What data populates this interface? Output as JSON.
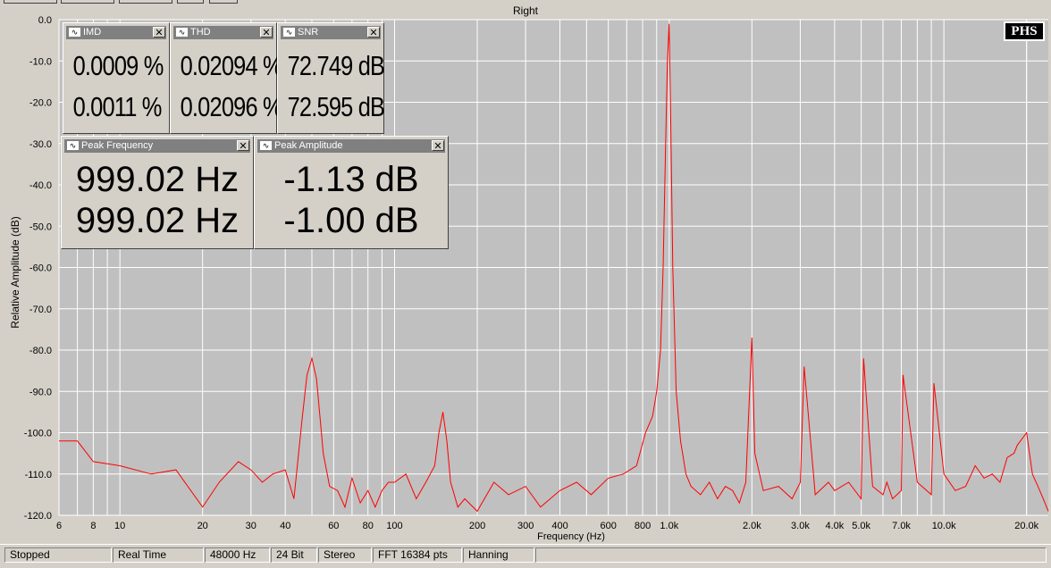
{
  "window": {
    "title": "Right"
  },
  "brand_badge": "PHS",
  "meters": {
    "imd": {
      "title": "IMD",
      "value1": "0.0009 %",
      "value2": "0.0011 %"
    },
    "thd": {
      "title": "THD",
      "value1": "0.02094 %",
      "value2": "0.02096 %"
    },
    "snr": {
      "title": "SNR",
      "value1": "72.749 dB",
      "value2": "72.595 dB"
    },
    "peak_frequency": {
      "title": "Peak Frequency",
      "value1": "999.02 Hz",
      "value2": "999.02 Hz"
    },
    "peak_amplitude": {
      "title": "Peak Amplitude",
      "value1": "-1.13 dB",
      "value2": "-1.00 dB"
    }
  },
  "close_glyph": "✕",
  "window_icon_glyph": "∿",
  "status": {
    "state": "Stopped",
    "mode": "Real Time",
    "sample_rate": "48000 Hz",
    "bit_depth": "24 Bit",
    "channels": "Stereo",
    "fft": "FFT 16384 pts",
    "window": "Hanning"
  },
  "colors": {
    "trace": "#ff0000",
    "plot_bg": "#c0c0c0",
    "grid": "#ffffff",
    "face": "#d4d0c8"
  },
  "chart_data": {
    "type": "line",
    "xlabel": "Frequency (Hz)",
    "ylabel": "Relative Amplitude (dB)",
    "xscale": "log",
    "xlim": [
      6,
      24000
    ],
    "ylim": [
      -120,
      0
    ],
    "grid": true,
    "ytick_labels": [
      "0.0",
      "-10.0",
      "-20.0",
      "-30.0",
      "-40.0",
      "-50.0",
      "-60.0",
      "-70.0",
      "-80.0",
      "-90.0",
      "-100.0",
      "-110.0",
      "-120.0"
    ],
    "ytick_values": [
      0,
      -10,
      -20,
      -30,
      -40,
      -50,
      -60,
      -70,
      -80,
      -90,
      -100,
      -110,
      -120
    ],
    "xtick_labels": [
      "6",
      "8",
      "10",
      "20",
      "30",
      "40",
      "60",
      "80",
      "100",
      "200",
      "300",
      "400",
      "600",
      "800",
      "1.0k",
      "2.0k",
      "3.0k",
      "4.0k",
      "5.0k",
      "7.0k",
      "10.0k",
      "20.0k"
    ],
    "xtick_values": [
      6,
      8,
      10,
      20,
      30,
      40,
      60,
      80,
      100,
      200,
      300,
      400,
      600,
      800,
      1000,
      2000,
      3000,
      4000,
      5000,
      7000,
      10000,
      20000
    ],
    "series": [
      {
        "x": [
          6,
          7,
          8,
          10,
          13,
          16,
          20,
          23,
          27,
          30,
          33,
          36,
          40,
          43,
          46,
          48,
          50,
          52,
          55,
          58,
          62,
          66,
          70,
          75,
          80,
          85,
          90,
          95,
          100,
          110,
          120,
          130,
          140,
          145,
          150,
          155,
          160,
          170,
          180,
          200,
          230,
          260,
          300,
          340,
          400,
          460,
          520,
          600,
          680,
          760,
          820,
          870,
          900,
          930,
          950,
          970,
          985,
          999,
          1010,
          1030,
          1060,
          1100,
          1150,
          1200,
          1300,
          1400,
          1500,
          1600,
          1700,
          1800,
          1900,
          2000,
          2050,
          2200,
          2500,
          2800,
          3000,
          3100,
          3400,
          3800,
          4000,
          4500,
          5000,
          5100,
          5500,
          6000,
          6200,
          6500,
          7000,
          7100,
          8000,
          9000,
          9200,
          10000,
          11000,
          12000,
          13000,
          14000,
          15000,
          16000,
          17000,
          18000,
          18500,
          19000,
          20000,
          21000,
          22000,
          23000,
          24000
        ],
        "y": [
          -102,
          -102,
          -107,
          -108,
          -110,
          -109,
          -118,
          -112,
          -107,
          -109,
          -112,
          -110,
          -109,
          -116,
          -97,
          -86,
          -82,
          -87,
          -105,
          -113,
          -114,
          -118,
          -111,
          -117,
          -114,
          -118,
          -114,
          -112,
          -112,
          -110,
          -116,
          -112,
          -108,
          -100,
          -95,
          -102,
          -112,
          -118,
          -116,
          -119,
          -112,
          -115,
          -113,
          -118,
          -114,
          -112,
          -115,
          -111,
          -110,
          -108,
          -100,
          -96,
          -90,
          -80,
          -60,
          -30,
          -10,
          -1,
          -20,
          -60,
          -90,
          -102,
          -110,
          -113,
          -115,
          -112,
          -116,
          -113,
          -114,
          -117,
          -112,
          -77,
          -105,
          -114,
          -113,
          -116,
          -112,
          -84,
          -115,
          -112,
          -114,
          -112,
          -116,
          -82,
          -113,
          -115,
          -112,
          -116,
          -114,
          -86,
          -112,
          -115,
          -88,
          -110,
          -114,
          -113,
          -108,
          -111,
          -110,
          -112,
          -106,
          -105,
          -103,
          -102,
          -100,
          -110,
          -113,
          -116,
          -119
        ]
      }
    ]
  }
}
